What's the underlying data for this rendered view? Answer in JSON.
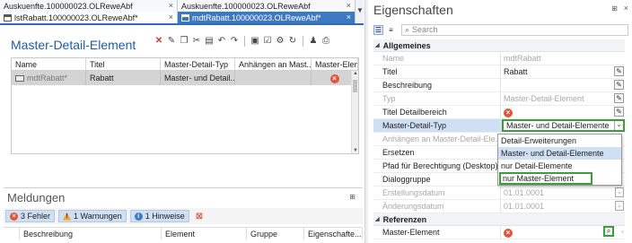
{
  "tabs": {
    "top_left": "Auskuenfte.100000023.OLReweAbf",
    "top_right": "Auskuenfte.100000023.OLReweAbf",
    "bottom_left": "lstRabatt.100000023.OLReweAbf*",
    "bottom_right": "mdtRabatt.100000023.OLReweAbf*",
    "close_glyph": "×",
    "overflow_glyph": "▼"
  },
  "editor": {
    "title": "Master-Detail-Element",
    "toolbar_icons": [
      "delete-icon",
      "edit-icon",
      "copy-icon",
      "cut-icon",
      "paste-icon",
      "undo-icon",
      "redo-icon",
      "save-icon",
      "check-icon",
      "settings-icon",
      "refresh-icon",
      "user-icon",
      "print-icon"
    ]
  },
  "grid": {
    "columns": [
      "Name",
      "Titel",
      "Master-Detail-Typ",
      "Anhängen an Mast...",
      "Master-Eleme"
    ],
    "rows": [
      {
        "name": "mdtRabatt*",
        "titel": "Rabatt",
        "typ": "Master- und Detail...",
        "anhaengen": "",
        "error": "×"
      }
    ]
  },
  "meldungen": {
    "title": "Meldungen",
    "pin": "⊞",
    "filters": [
      {
        "label": "3 Fehler",
        "kind": "error"
      },
      {
        "label": "1 Warnungen",
        "kind": "warning"
      },
      {
        "label": "1 Hinweise",
        "kind": "info"
      }
    ],
    "columns": [
      "Beschreibung",
      "Element",
      "Gruppe",
      "Eigenschafte..."
    ]
  },
  "properties": {
    "title": "Eigenschaften",
    "pin": "⊞",
    "close": "×",
    "search_placeholder": "Search",
    "categories": {
      "allgemeines": "Allgemeines",
      "referenzen": "Referenzen"
    },
    "rows": [
      {
        "name": "Name",
        "value": "mdtRabatt",
        "disabled": true
      },
      {
        "name": "Titel",
        "value": "Rabatt",
        "edit": true
      },
      {
        "name": "Beschreibung",
        "value": "",
        "edit": true
      },
      {
        "name": "Typ",
        "value": "Master-Detail-Element",
        "disabled": true,
        "edit": true
      },
      {
        "name": "Titel Detailbereich",
        "value": "",
        "error": true,
        "edit": true
      },
      {
        "name": "Master-Detail-Typ",
        "value": "Master- und Detail-Elemente",
        "combo": true
      },
      {
        "name": "Anhängen an Master-Detail-Ele...",
        "value": "Detail-Erweiterungen",
        "disabled": true
      },
      {
        "name": "Ersetzen",
        "value": ""
      },
      {
        "name": "Pfad für Berechtigung (Desktop)",
        "value": ""
      },
      {
        "name": "Dialoggruppe",
        "value": ""
      },
      {
        "name": "Erstellungsdatum",
        "value": "01.01.0001",
        "disabled": true
      },
      {
        "name": "Änderungsdatum",
        "value": "01.01.0001",
        "disabled": true
      }
    ],
    "referenzen_rows": [
      {
        "name": "Master-Element",
        "value": "",
        "error": true,
        "lookup": true
      }
    ],
    "dropdown_options": [
      "Detail-Erweiterungen",
      "Master- und Detail-Elemente",
      "nur Detail-Elemente",
      "nur Master-Element"
    ],
    "dropdown_highlighted": "Master- und Detail-Elemente",
    "dropdown_boxed": "nur Master-Element"
  },
  "colors": {
    "accent": "#2f6eb5",
    "active_tab": "#3d78c3",
    "title_blue": "#1f5da8",
    "error_red": "#e2543c",
    "highlight_green": "#3e9c3e",
    "selection": "#cfe0f5"
  }
}
